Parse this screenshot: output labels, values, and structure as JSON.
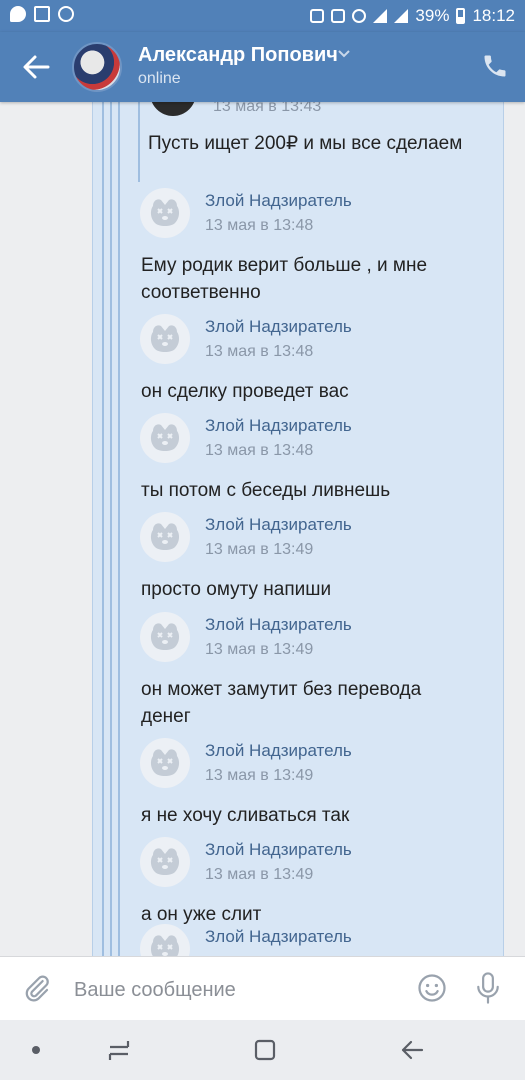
{
  "status_bar": {
    "battery": "39%",
    "time": "18:12"
  },
  "header": {
    "name": "Александр Попович",
    "status": "online"
  },
  "chat": {
    "top_partial": {
      "time": "13 мая в 13:43",
      "text": "Пусть ищет 200₽ и мы все сделаем"
    },
    "messages": [
      {
        "author": "Злой Надзиратель",
        "time": "13 мая в 13:48",
        "text": "Ему родик верит больше , и мне соответвенно"
      },
      {
        "author": "Злой Надзиратель",
        "time": "13 мая в 13:48",
        "text": "он сделку проведет вас"
      },
      {
        "author": "Злой Надзиратель",
        "time": "13 мая в 13:48",
        "text": "ты потом с беседы ливнешь"
      },
      {
        "author": "Злой Надзиратель",
        "time": "13 мая в 13:49",
        "text": "просто омуту напиши"
      },
      {
        "author": "Злой Надзиратель",
        "time": "13 мая в 13:49",
        "text": "он может замутит без перевода денег"
      },
      {
        "author": "Злой Надзиратель",
        "time": "13 мая в 13:49",
        "text": "я не хочу сливаться так"
      },
      {
        "author": "Злой Надзиратель",
        "time": "13 мая в 13:49",
        "text": "а он уже слит"
      },
      {
        "author": "Злой Надзиратель",
        "time": "",
        "text": ""
      }
    ]
  },
  "input": {
    "placeholder": "Ваше сообщение"
  },
  "colors": {
    "header": "#5181b8",
    "forward_bg": "#d8e6f5",
    "author": "#42658f"
  }
}
